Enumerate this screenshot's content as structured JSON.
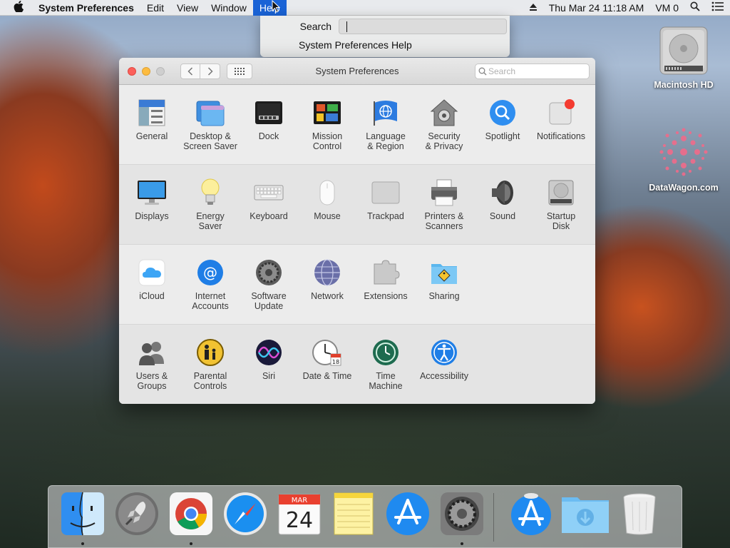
{
  "menubar": {
    "app_name": "System Preferences",
    "items": [
      "Edit",
      "View",
      "Window",
      "Help"
    ],
    "date_time": "Thu Mar 24  11:18 AM",
    "user": "VM 0"
  },
  "help_menu": {
    "search_label": "Search",
    "search_value": "",
    "item": "System Preferences Help"
  },
  "window": {
    "title": "System Preferences",
    "search_placeholder": "Search",
    "rows": [
      [
        {
          "label": "General"
        },
        {
          "label": "Desktop &\nScreen Saver"
        },
        {
          "label": "Dock"
        },
        {
          "label": "Mission\nControl"
        },
        {
          "label": "Language\n& Region"
        },
        {
          "label": "Security\n& Privacy"
        },
        {
          "label": "Spotlight"
        },
        {
          "label": "Notifications"
        }
      ],
      [
        {
          "label": "Displays"
        },
        {
          "label": "Energy\nSaver"
        },
        {
          "label": "Keyboard"
        },
        {
          "label": "Mouse"
        },
        {
          "label": "Trackpad"
        },
        {
          "label": "Printers &\nScanners"
        },
        {
          "label": "Sound"
        },
        {
          "label": "Startup\nDisk"
        }
      ],
      [
        {
          "label": "iCloud"
        },
        {
          "label": "Internet\nAccounts"
        },
        {
          "label": "Software\nUpdate"
        },
        {
          "label": "Network"
        },
        {
          "label": "Extensions"
        },
        {
          "label": "Sharing"
        }
      ],
      [
        {
          "label": "Users &\nGroups"
        },
        {
          "label": "Parental\nControls"
        },
        {
          "label": "Siri"
        },
        {
          "label": "Date & Time"
        },
        {
          "label": "Time\nMachine"
        },
        {
          "label": "Accessibility"
        }
      ]
    ]
  },
  "desktop": {
    "icons": [
      "Macintosh HD",
      "DataWagon.com"
    ]
  },
  "dock": {
    "items": [
      "Finder",
      "Launchpad",
      "Google Chrome",
      "Safari",
      "Calendar",
      "Notes",
      "App Store",
      "System Preferences",
      "Downloads App Store",
      "Downloads",
      "Trash"
    ],
    "calendar_month": "MAR",
    "calendar_day": "24"
  },
  "colors": {
    "menu_highlight": "#1a63d6",
    "close": "#fc605b",
    "minimize": "#fdbc40"
  }
}
